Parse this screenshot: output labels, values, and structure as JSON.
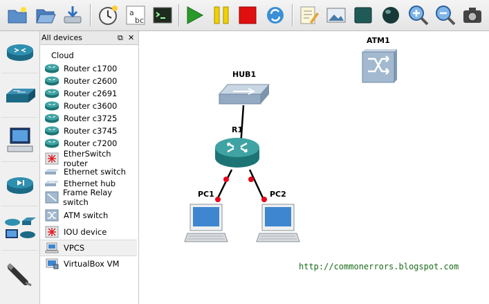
{
  "toolbar": {
    "buttons": [
      {
        "name": "new-project-icon"
      },
      {
        "name": "open-project-icon"
      },
      {
        "name": "save-project-icon"
      },
      {
        "name": "snapshot-icon"
      },
      {
        "name": "show-hostnames-icon"
      },
      {
        "name": "console-icon"
      },
      {
        "name": "start-icon"
      },
      {
        "name": "suspend-icon"
      },
      {
        "name": "stop-icon"
      },
      {
        "name": "reload-icon"
      },
      {
        "name": "add-note-icon"
      },
      {
        "name": "insert-picture-icon"
      },
      {
        "name": "draw-rectangle-icon"
      },
      {
        "name": "draw-ellipse-icon"
      },
      {
        "name": "zoom-in-icon"
      },
      {
        "name": "zoom-out-icon"
      },
      {
        "name": "screenshot-icon"
      }
    ]
  },
  "left_categories": [
    {
      "name": "routers-icon"
    },
    {
      "name": "switches-icon"
    },
    {
      "name": "end-devices-icon"
    },
    {
      "name": "security-devices-icon"
    },
    {
      "name": "all-devices-icon"
    },
    {
      "name": "add-link-icon"
    }
  ],
  "panel": {
    "title": "All devices",
    "float_glyph": "⧉",
    "close_glyph": "✕",
    "devices": [
      {
        "label": "Cloud",
        "icon": "none"
      },
      {
        "label": "Router c1700",
        "icon": "router"
      },
      {
        "label": "Router c2600",
        "icon": "router"
      },
      {
        "label": "Router c2691",
        "icon": "router"
      },
      {
        "label": "Router c3600",
        "icon": "router"
      },
      {
        "label": "Router c3725",
        "icon": "router"
      },
      {
        "label": "Router c3745",
        "icon": "router"
      },
      {
        "label": "Router c7200",
        "icon": "router"
      },
      {
        "label": "EtherSwitch router",
        "icon": "etherswitch"
      },
      {
        "label": "Ethernet switch",
        "icon": "switch"
      },
      {
        "label": "Ethernet hub",
        "icon": "hub"
      },
      {
        "label": "Frame Relay switch",
        "icon": "framerelay"
      },
      {
        "label": "ATM switch",
        "icon": "atm"
      },
      {
        "label": "IOU device",
        "icon": "iou"
      },
      {
        "label": "VPCS",
        "icon": "pc",
        "selected": true
      },
      {
        "label": "VirtualBox VM",
        "icon": "vbox"
      }
    ]
  },
  "topology": {
    "nodes": [
      {
        "id": "ATM1",
        "label": "ATM1",
        "type": "atm-switch"
      },
      {
        "id": "HUB1",
        "label": "HUB1",
        "type": "ethernet-hub"
      },
      {
        "id": "R1",
        "label": "R1",
        "type": "router"
      },
      {
        "id": "PC1",
        "label": "PC1",
        "type": "vpcs"
      },
      {
        "id": "PC2",
        "label": "PC2",
        "type": "vpcs"
      }
    ],
    "links": [
      {
        "from": "HUB1",
        "to": "R1"
      },
      {
        "from": "R1",
        "to": "PC1"
      },
      {
        "from": "R1",
        "to": "PC2"
      }
    ]
  },
  "watermark": "http://commonerrors.blogspot.com",
  "colors": {
    "router": "#2a8f8f",
    "link": "#000000",
    "endpoint": "#e8001c",
    "url": "#1a6b1a",
    "stop": "#e01010",
    "start": "#2a9a2a",
    "suspend": "#f0d000"
  }
}
